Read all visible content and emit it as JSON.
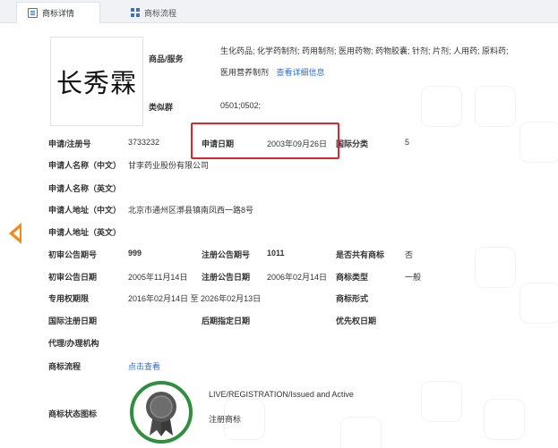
{
  "tabs": [
    {
      "label": "商标详情",
      "active": true,
      "icon": "document-icon"
    },
    {
      "label": "商标流程",
      "active": false,
      "icon": "grid-icon"
    }
  ],
  "trademark": {
    "image_text": "长秀霖",
    "goods_services_label": "商品/服务",
    "goods_services_value": "生化药品; 化学药制剂; 药用制剂; 医用药物; 药物胶囊; 针剂; 片剂; 人用药; 原料药; 医用营养制剂",
    "goods_services_link": "查看详细信息",
    "similar_group_label": "类似群",
    "similar_group_value": "0501;0502;"
  },
  "rows": {
    "reg_no_label": "申请/注册号",
    "reg_no_value": "3733232",
    "app_date_label": "申请日期",
    "app_date_value": "2003年09月26日",
    "intl_class_label": "国际分类",
    "intl_class_value": "5",
    "applicant_cn_label": "申请人名称（中文）",
    "applicant_cn_value": "甘李药业股份有限公司",
    "applicant_en_label": "申请人名称（英文）",
    "address_cn_label": "申请人地址（中文）",
    "address_cn_value": "北京市通州区漷县镇南凤西一路8号",
    "address_en_label": "申请人地址（英文）",
    "prelim_no_label": "初审公告期号",
    "prelim_no_value": "999",
    "reg_pub_no_label": "注册公告期号",
    "reg_pub_no_value": "1011",
    "shared_label": "是否共有商标",
    "shared_value": "否",
    "prelim_date_label": "初审公告日期",
    "prelim_date_value": "2005年11月14日",
    "reg_pub_date_label": "注册公告日期",
    "reg_pub_date_value": "2006年02月14日",
    "type_label": "商标类型",
    "type_value": "一般",
    "exclusive_label": "专用权期限",
    "exclusive_value": "2016年02月14日 至 2026年02月13日",
    "form_label": "商标形式",
    "intl_reg_date_label": "国际注册日期",
    "later_designation_label": "后期指定日期",
    "priority_date_label": "优先权日期",
    "agent_label": "代理/办理机构",
    "process_label": "商标流程",
    "process_link": "点击查看",
    "status_label": "商标状态图标",
    "status_line1": "LIVE/REGISTRATION/Issued and Active",
    "status_line2": "注册商标"
  },
  "colors": {
    "accent": "#2f6cd6",
    "highlight": "#e0242b",
    "seal": "#2e8f3e",
    "arrow": "#f28b1c"
  }
}
